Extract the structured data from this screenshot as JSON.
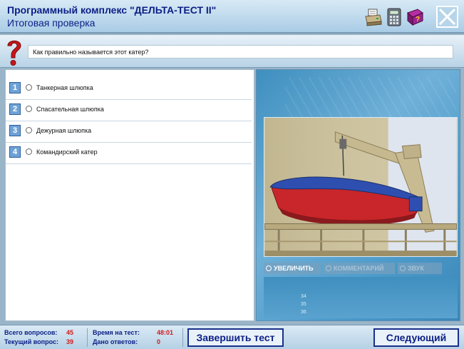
{
  "header": {
    "title": "Программный комплекс \"ДЕЛЬТА-ТЕСТ II\"",
    "subtitle": "Итоговая проверка",
    "icons": [
      "printer-icon",
      "calculator-icon",
      "help-book-icon",
      "close-icon"
    ]
  },
  "question": {
    "text": "Как правильно называется этот катер?"
  },
  "answers": [
    {
      "num": "1",
      "text": "Танкерная шлюпка"
    },
    {
      "num": "2",
      "text": "Спасательная шлюпка"
    },
    {
      "num": "3",
      "text": "Дежурная шлюпка"
    },
    {
      "num": "4",
      "text": "Командирский катер"
    }
  ],
  "image_panel": {
    "zoom_label": "УВЕЛИЧИТЬ",
    "comment_label": "КОММЕНТАРИЙ",
    "sound_label": "ЗВУК",
    "ruler": [
      "34",
      "35",
      "36"
    ]
  },
  "footer": {
    "total_questions_label": "Всего вопросов:",
    "total_questions_value": "45",
    "current_question_label": "Текущий вопрос:",
    "current_question_value": "39",
    "time_label": "Время на тест:",
    "time_value": "48:01",
    "answers_given_label": "Дано ответов:",
    "answers_given_value": "0",
    "finish_label": "Завершить тест",
    "next_label": "Следующий"
  },
  "colors": {
    "title_blue": "#0b1f86",
    "value_red": "#d21b1b",
    "panel_blue": "#4e9ccb"
  }
}
